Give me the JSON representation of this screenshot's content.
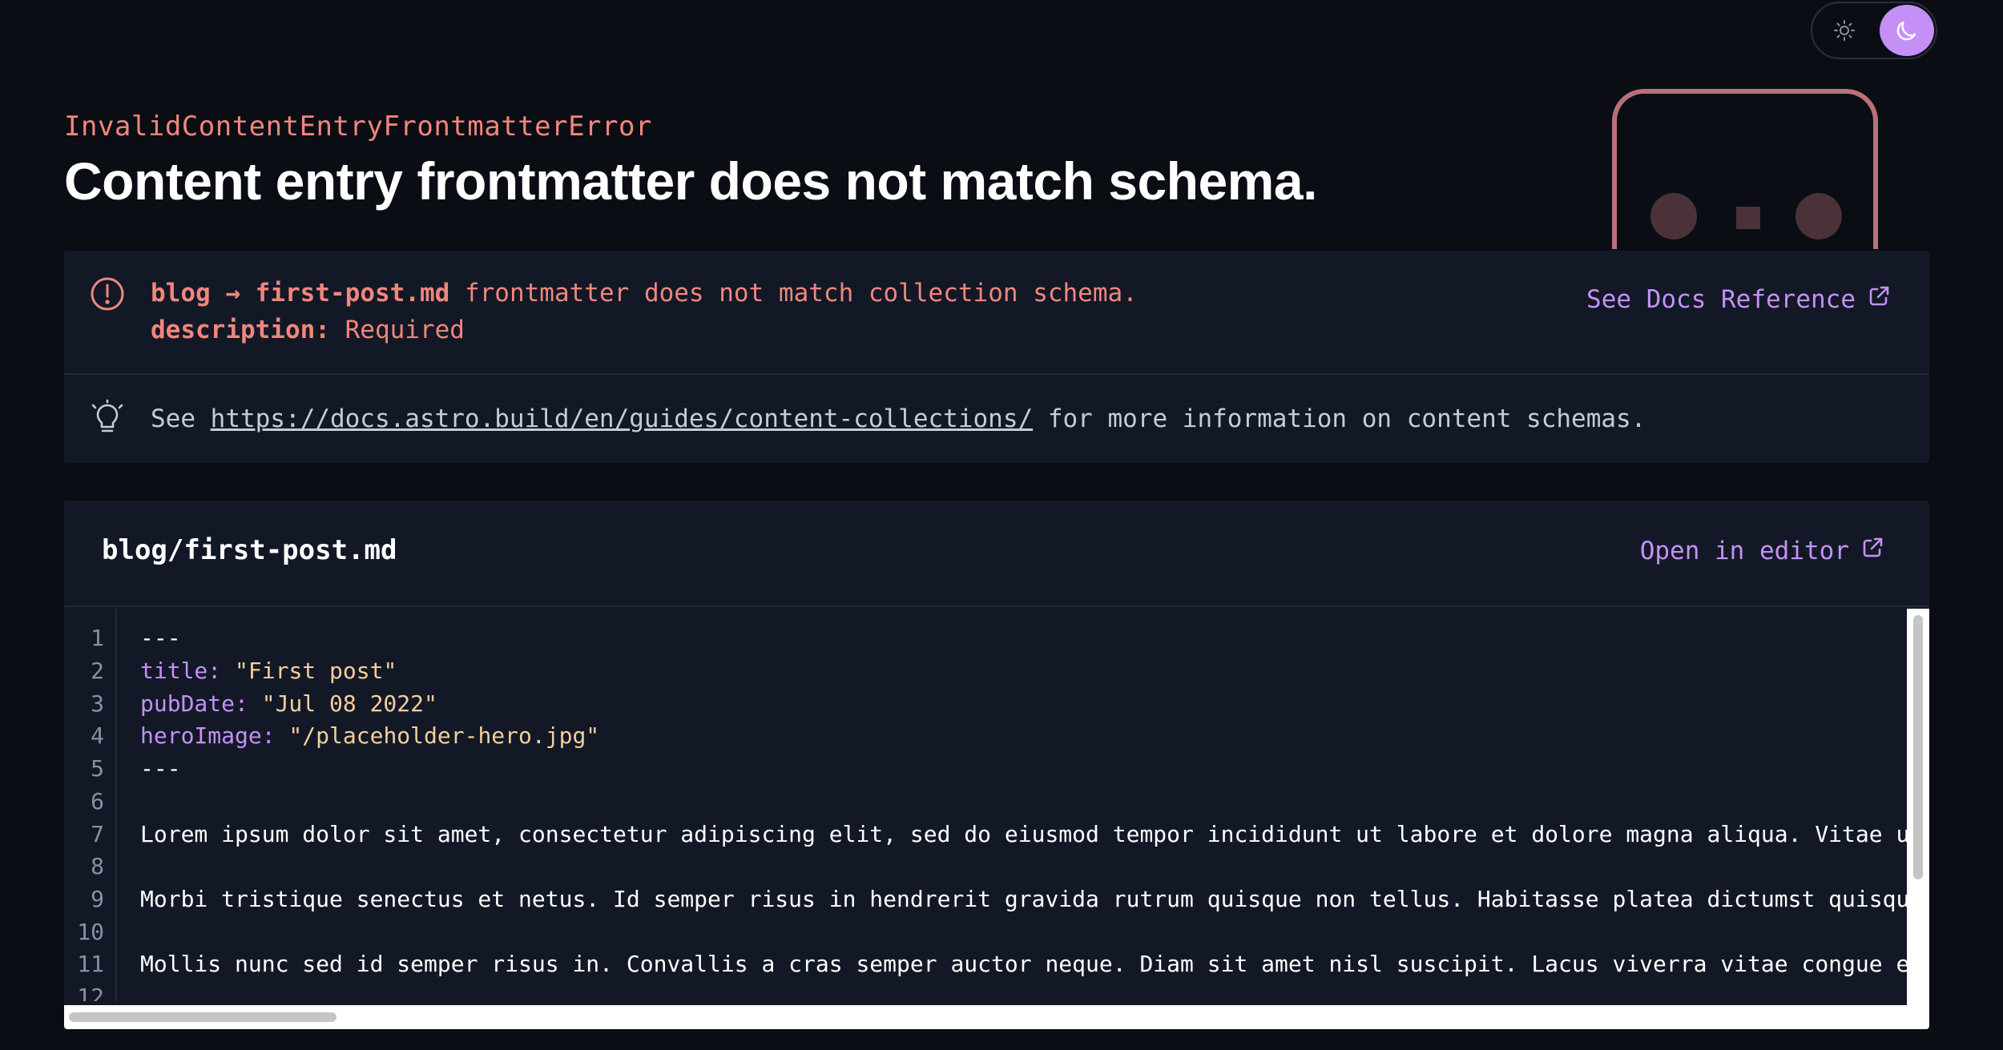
{
  "theme_toggle": {
    "light_icon": "sun-icon",
    "dark_icon": "moon-icon",
    "active": "dark",
    "active_color": "#c490f5"
  },
  "error": {
    "name": "InvalidContentEntryFrontmatterError",
    "title": "Content entry frontmatter does not match schema."
  },
  "message": {
    "icon": "alert-circle-icon",
    "collection": "blog",
    "arrow": "→",
    "entry": "first-post.md",
    "text": " frontmatter does not match collection schema.",
    "field": "description:",
    "field_error": " Required",
    "docs_label": "See Docs Reference"
  },
  "hint": {
    "icon": "lightbulb-icon",
    "prefix": "See ",
    "link": "https://docs.astro.build/en/guides/content-collections/",
    "suffix": " for more information on content schemas."
  },
  "code": {
    "filename": "blog/first-post.md",
    "open_label": "Open in editor",
    "lines": [
      {
        "num": "1",
        "text": "---"
      },
      {
        "num": "2",
        "key": "title:",
        "value": " \"First post\""
      },
      {
        "num": "3",
        "key": "pubDate:",
        "value": " \"Jul 08 2022\""
      },
      {
        "num": "4",
        "key": "heroImage:",
        "value": " \"/placeholder-hero.jpg\""
      },
      {
        "num": "5",
        "text": "---"
      },
      {
        "num": "6",
        "text": ""
      },
      {
        "num": "7",
        "text": "Lorem ipsum dolor sit amet, consectetur adipiscing elit, sed do eiusmod tempor incididunt ut labore et dolore magna aliqua. Vitae ultri"
      },
      {
        "num": "8",
        "text": ""
      },
      {
        "num": "9",
        "text": "Morbi tristique senectus et netus. Id semper risus in hendrerit gravida rutrum quisque non tellus. Habitasse platea dictumst quisque sa"
      },
      {
        "num": "10",
        "text": ""
      },
      {
        "num": "11",
        "text": "Mollis nunc sed id semper risus in. Convallis a cras semper auctor neque. Diam sit amet nisl suscipit. Lacus viverra vitae congue eu co"
      },
      {
        "num": "12",
        "text": ""
      }
    ]
  },
  "colors": {
    "background": "#0b0d14",
    "panel": "#131827",
    "error": "#f0867c",
    "accent": "#c490f5",
    "string": "#f3cf9a"
  }
}
